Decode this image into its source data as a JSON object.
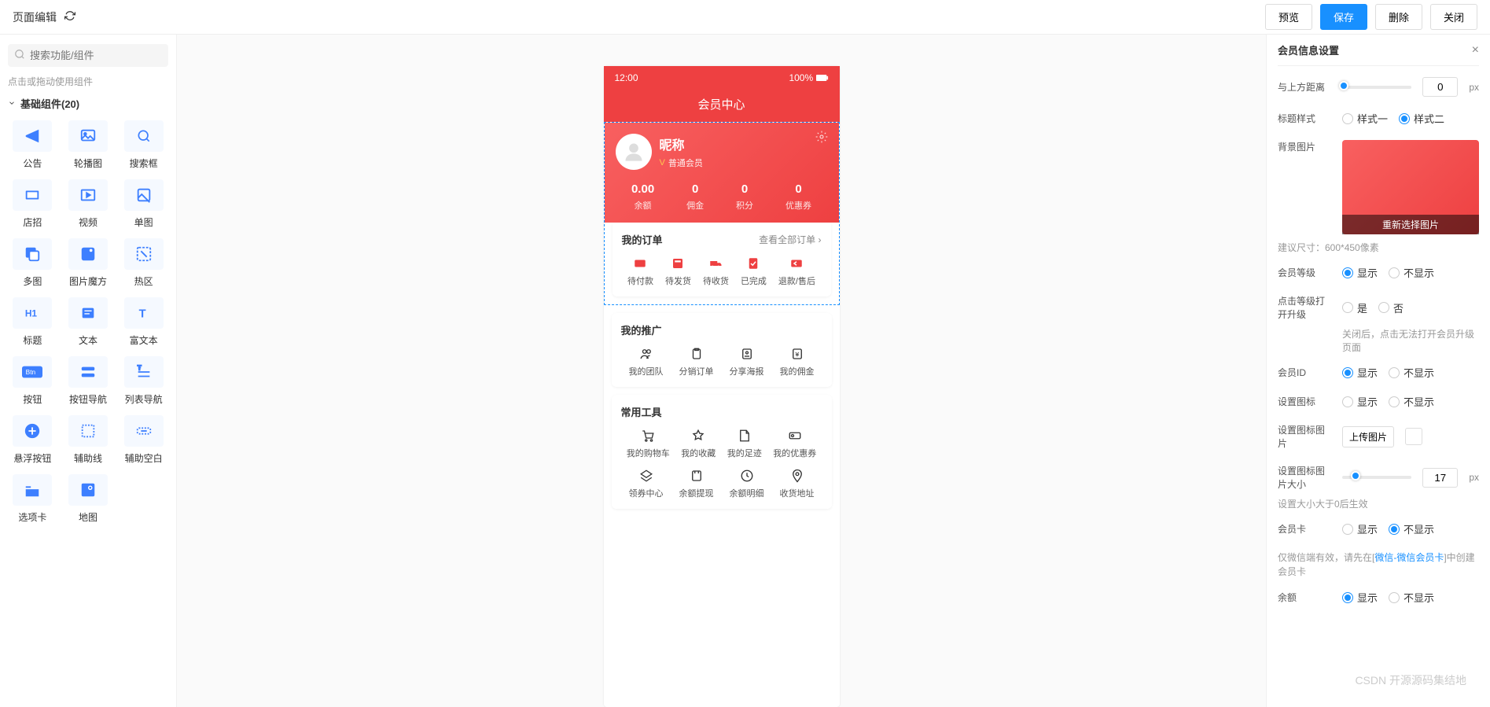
{
  "header": {
    "title": "页面编辑",
    "buttons": {
      "preview": "预览",
      "save": "保存",
      "delete": "删除",
      "close": "关闭"
    }
  },
  "left": {
    "search_placeholder": "搜索功能/组件",
    "hint": "点击或拖动使用组件",
    "group_title": "基础组件(20)",
    "components": [
      "公告",
      "轮播图",
      "搜索框",
      "店招",
      "视频",
      "单图",
      "多图",
      "图片魔方",
      "热区",
      "标题",
      "文本",
      "富文本",
      "按钮",
      "按钮导航",
      "列表导航",
      "悬浮按钮",
      "辅助线",
      "辅助空白",
      "选项卡",
      "地图"
    ]
  },
  "phone": {
    "time": "12:00",
    "battery": "100%",
    "title": "会员中心",
    "nickname": "昵称",
    "level": "普通会员",
    "stats": [
      {
        "val": "0.00",
        "lbl": "余额"
      },
      {
        "val": "0",
        "lbl": "佣金"
      },
      {
        "val": "0",
        "lbl": "积分"
      },
      {
        "val": "0",
        "lbl": "优惠券"
      }
    ],
    "orders": {
      "title": "我的订单",
      "more": "查看全部订单 ›",
      "items": [
        "待付款",
        "待发货",
        "待收货",
        "已完成",
        "退款/售后"
      ]
    },
    "promo": {
      "title": "我的推广",
      "items": [
        "我的团队",
        "分销订单",
        "分享海报",
        "我的佣金"
      ]
    },
    "tools": {
      "title": "常用工具",
      "row1": [
        "我的购物车",
        "我的收藏",
        "我的足迹",
        "我的优惠券"
      ],
      "row2": [
        "领券中心",
        "余额提现",
        "余额明细",
        "收货地址"
      ]
    }
  },
  "right": {
    "panel_title": "会员信息设置",
    "distance_label": "与上方距离",
    "distance_value": "0",
    "px": "px",
    "title_style_label": "标题样式",
    "style1": "样式一",
    "style2": "样式二",
    "bg_label": "背景图片",
    "bg_reselect": "重新选择图片",
    "bg_hint": "建议尺寸：600*450像素",
    "level_label": "会员等级",
    "upgrade_label": "点击等级打开升级",
    "yes": "是",
    "no": "否",
    "upgrade_hint": "关闭后，点击无法打开会员升级页面",
    "id_label": "会员ID",
    "seticon_label": "设置图标",
    "seticonimg_label": "设置图标图片",
    "upload": "上传图片",
    "iconsize_label": "设置图标图片大小",
    "iconsize_value": "17",
    "iconsize_hint": "设置大小大于0后生效",
    "card_label": "会员卡",
    "card_hint_pre": "仅微信端有效，请先在[",
    "card_hint_link": "微信-微信会员卡",
    "card_hint_post": "]中创建会员卡",
    "balance_label": "余额",
    "show": "显示",
    "hide": "不显示"
  },
  "watermark": "CSDN 开源源码集结地"
}
